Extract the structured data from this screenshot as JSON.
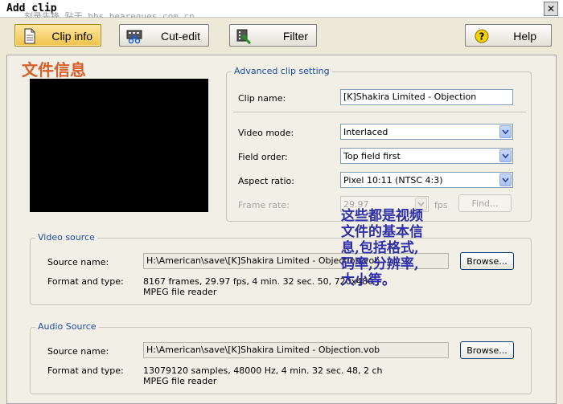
{
  "window": {
    "title": "Add clip",
    "watermark": "刻录先锋 贴于 bbs.bearegues.com.cn",
    "close_glyph": "✕"
  },
  "toolbar": {
    "clip_info": "Clip info",
    "cut_edit": "Cut-edit",
    "filter": "Filter",
    "help": "Help"
  },
  "heading_cn": "文件信息",
  "advanced": {
    "legend": "Advanced clip setting",
    "clip_name_label": "Clip name:",
    "clip_name_value": "[K]Shakira Limited - Objection",
    "video_mode_label": "Video mode:",
    "video_mode_value": "Interlaced",
    "field_order_label": "Field order:",
    "field_order_value": "Top field first",
    "aspect_ratio_label": "Aspect ratio:",
    "aspect_ratio_value": "Pixel 10:11 (NTSC 4:3)",
    "frame_rate_label": "Frame rate:",
    "frame_rate_value": "29.97",
    "fps_label": "fps",
    "find_button": "Find..."
  },
  "video_source": {
    "legend": "Video source",
    "source_name_label": "Source name:",
    "source_name_value": "H:\\American\\save\\[K]Shakira Limited - Objection.vob",
    "browse_button": "Browse...",
    "format_label": "Format and type:",
    "format_line1": "8167 frames, 29.97 fps, 4 min. 32 sec. 50, 720x480",
    "format_line2": "MPEG file reader"
  },
  "audio_source": {
    "legend": "Audio Source",
    "source_name_label": "Source name:",
    "source_name_value": "H:\\American\\save\\[K]Shakira Limited - Objection.vob",
    "browse_button": "Browse...",
    "format_label": "Format and type:",
    "format_line1": "13079120 samples, 48000 Hz, 4 min. 32 sec. 48, 2 ch",
    "format_line2": "MPEG file reader"
  },
  "annotation": {
    "line1": "这些都是视频",
    "line2": "文件的基本信",
    "line3": "息,包括格式,",
    "line4": "码率,分辨率,",
    "line5": "大小等。"
  },
  "colors": {
    "accent_blue": "#1f4ca3",
    "active_tab": "#f1c24a",
    "heading_orange": "#d85e2a",
    "annotation_blue": "#2e2ea8"
  }
}
